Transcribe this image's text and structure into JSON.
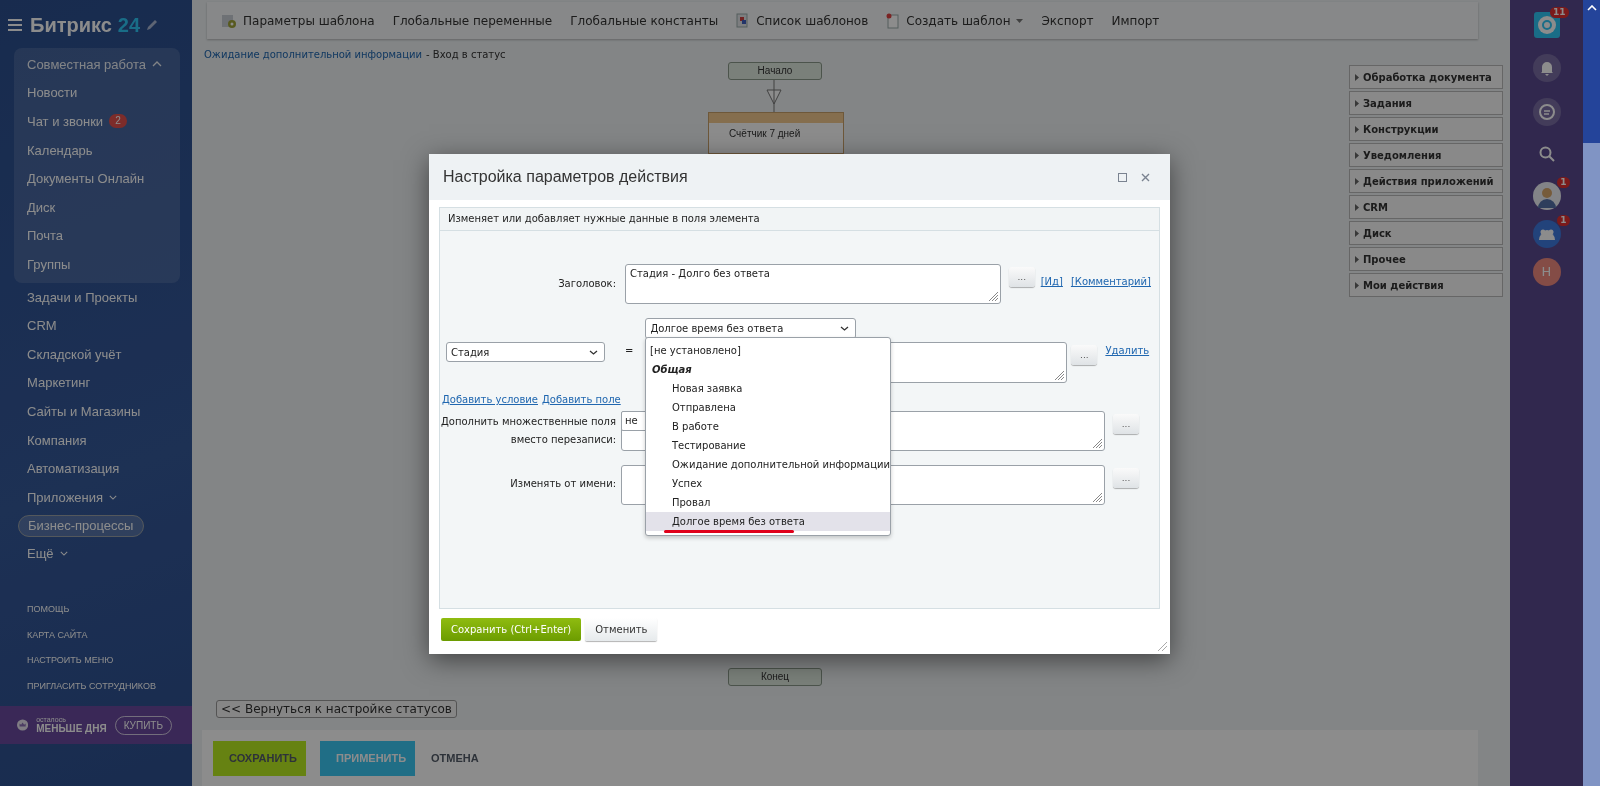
{
  "sidebar": {
    "logo": "Битрикс",
    "logo_number": "24",
    "menu": [
      {
        "label": "Совместная работа",
        "expanded": true,
        "selected": false,
        "children": [
          {
            "label": "Новости",
            "selected": false
          },
          {
            "label": "Чат и звонки",
            "counter": "2",
            "selected": false
          },
          {
            "label": "Календарь",
            "selected": false
          },
          {
            "label": "Документы Онлайн",
            "selected": false
          },
          {
            "label": "Диск",
            "selected": false
          },
          {
            "label": "Почта",
            "selected": false
          },
          {
            "label": "Группы",
            "selected": false
          }
        ]
      },
      {
        "label": "Задачи и Проекты",
        "selected": false
      },
      {
        "label": "CRM",
        "selected": false
      },
      {
        "label": "Складской учёт",
        "selected": false
      },
      {
        "label": "Маркетинг",
        "selected": false
      },
      {
        "label": "Сайты и Магазины",
        "selected": false
      },
      {
        "label": "Компания",
        "selected": false
      },
      {
        "label": "Автоматизация",
        "selected": false
      },
      {
        "label": "Приложения",
        "expanded": false,
        "selected": false
      },
      {
        "label": "Бизнес-процессы",
        "selected": true
      },
      {
        "label": "Ещё",
        "expanded": false,
        "selected": false
      }
    ],
    "footer_links": [
      "ПОМОЩЬ",
      "КАРТА САЙТА",
      "НАСТРОИТЬ МЕНЮ",
      "ПРИГЛАСИТЬ СОТРУДНИКОВ"
    ],
    "trial": {
      "caption": "осталось",
      "text": "МЕНЬШЕ ДНЯ",
      "button": "КУПИТЬ"
    }
  },
  "toolbar": [
    {
      "label": "Параметры шаблона"
    },
    {
      "label": "Глобальные переменные"
    },
    {
      "label": "Глобальные константы"
    },
    {
      "label": "Список шаблонов"
    },
    {
      "label": "Создать шаблон",
      "has_menu": true
    },
    {
      "label": "Экспорт"
    },
    {
      "label": "Импорт"
    }
  ],
  "breadcrumb": {
    "link": "Ожидание дополнительной информации",
    "rest": "- Вход в статус"
  },
  "diagram": {
    "start": "Начало",
    "activity": "Счётчик 7 дней",
    "end": "Конец"
  },
  "back_button": "<< Вернуться к настройке статусов",
  "bottom_buttons": {
    "save": "СОХРАНИТЬ",
    "apply": "ПРИМЕНИТЬ",
    "cancel": "ОТМЕНА"
  },
  "palette": [
    "Обработка документа",
    "Задания",
    "Конструкции",
    "Уведомления",
    "Действия приложений",
    "CRM",
    "Диск",
    "Прочее",
    "Мои действия"
  ],
  "right_bar": {
    "help_counter": "11",
    "avatar_counter": "1",
    "group_chat_counter": "1",
    "user_initial": "Н"
  },
  "dialog": {
    "title": "Настройка параметров действия",
    "description": "Изменяет или добавляет нужные данные в поля элемента",
    "title_field": {
      "label": "Заголовок:",
      "value": "Стадия - Долго без ответа",
      "button": "...",
      "links": [
        "[Ид]",
        "[Комментарий]"
      ]
    },
    "condition": {
      "field": "Стадия",
      "operator": "=",
      "value": "Долгое время без ответа",
      "button": "...",
      "remove_link": "Удалить"
    },
    "add_links": [
      "Добавить условие",
      "Добавить поле"
    ],
    "append_field": {
      "label": "Дополнить множественные поля вместо перезаписи:",
      "value": "не",
      "button": "..."
    },
    "author_field": {
      "label": "Изменять от имени:",
      "button": "..."
    },
    "dropdown": [
      {
        "label": "[не установлено]",
        "kind": "option",
        "selected": false
      },
      {
        "label": "Общая",
        "kind": "group",
        "selected": false
      },
      {
        "label": "Новая заявка",
        "kind": "option",
        "selected": false
      },
      {
        "label": "Отправлена",
        "kind": "option",
        "selected": false
      },
      {
        "label": "В работе",
        "kind": "option",
        "selected": false
      },
      {
        "label": "Тестирование",
        "kind": "option",
        "selected": false
      },
      {
        "label": "Ожидание дополнительной информации",
        "kind": "option",
        "selected": false
      },
      {
        "label": "Успех",
        "kind": "option",
        "selected": false
      },
      {
        "label": "Провал",
        "kind": "option",
        "selected": false
      },
      {
        "label": "Долгое время без ответа",
        "kind": "option",
        "selected": true
      }
    ],
    "save_button": "Сохранить (Ctrl+Enter)",
    "cancel_button": "Отменить"
  }
}
